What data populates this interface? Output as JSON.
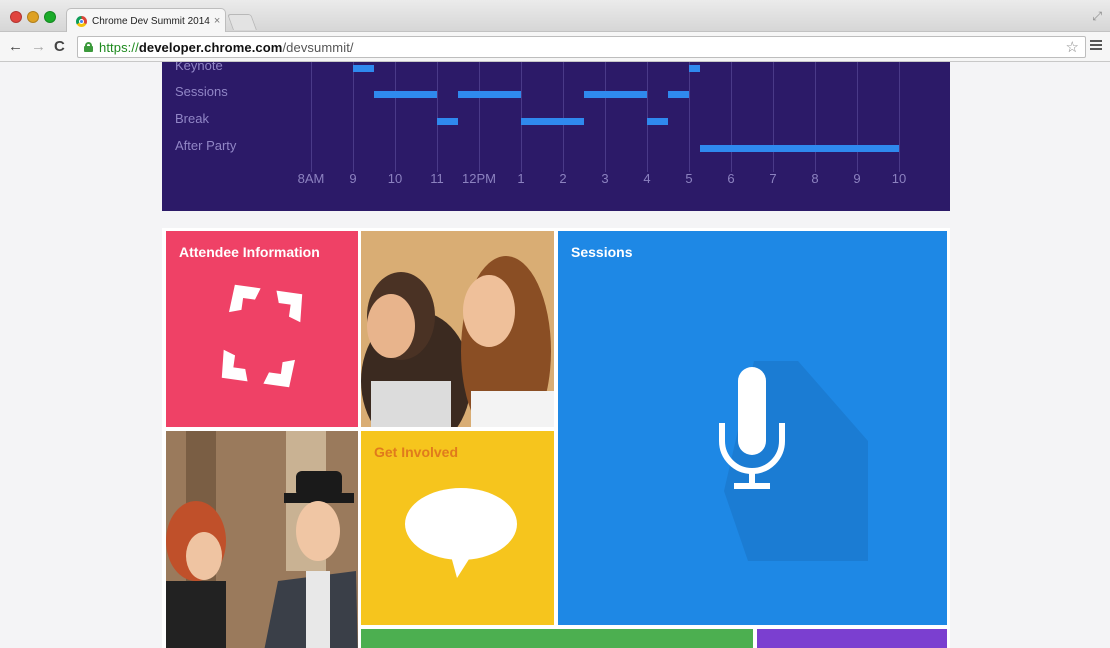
{
  "browser": {
    "tab_title": "Chrome Dev Summit 2014",
    "tab_close": "×",
    "url_scheme": "https://",
    "url_host": "developer.chrome.com",
    "url_path": "/devsummit/",
    "back_glyph": "←",
    "forward_glyph": "→",
    "reload_glyph": "C",
    "star_glyph": "☆",
    "resize_glyph": "⤢",
    "icons": [
      "close-icon",
      "minimize-icon",
      "maximize-icon",
      "favicon-icon",
      "back-arrow-icon",
      "forward-arrow-icon",
      "reload-icon",
      "lock-icon",
      "star-icon",
      "menu-icon"
    ]
  },
  "schedule": {
    "rows": [
      "Keynote",
      "Sessions",
      "Break",
      "After Party"
    ],
    "ticks": [
      "8AM",
      "9",
      "10",
      "11",
      "12PM",
      "1",
      "2",
      "3",
      "4",
      "5",
      "6",
      "7",
      "8",
      "9",
      "10"
    ],
    "events": [
      {
        "row": 0,
        "start": 9.0,
        "end": 9.5
      },
      {
        "row": 0,
        "start": 17.0,
        "end": 17.25
      },
      {
        "row": 1,
        "start": 9.5,
        "end": 11.0
      },
      {
        "row": 1,
        "start": 11.5,
        "end": 13.0
      },
      {
        "row": 1,
        "start": 14.5,
        "end": 16.0
      },
      {
        "row": 1,
        "start": 16.5,
        "end": 17.0
      },
      {
        "row": 2,
        "start": 11.0,
        "end": 11.5
      },
      {
        "row": 2,
        "start": 13.0,
        "end": 14.5
      },
      {
        "row": 2,
        "start": 16.0,
        "end": 16.5
      },
      {
        "row": 3,
        "start": 17.25,
        "end": 22.0
      }
    ],
    "colors": {
      "background": "#2c1a68",
      "bar": "#2f89ee"
    }
  },
  "tiles": {
    "attendee_title": "Attendee Information",
    "sessions_title": "Sessions",
    "involved_title": "Get Involved",
    "colors": {
      "attendee": "#ef4166",
      "sessions": "#1e88e5",
      "involved": "#f6c51d",
      "green": "#4caf50",
      "purple": "#7b3fd0"
    },
    "icons": [
      "viewfinder-icon",
      "microphone-icon",
      "speech-bubble-icon"
    ]
  }
}
